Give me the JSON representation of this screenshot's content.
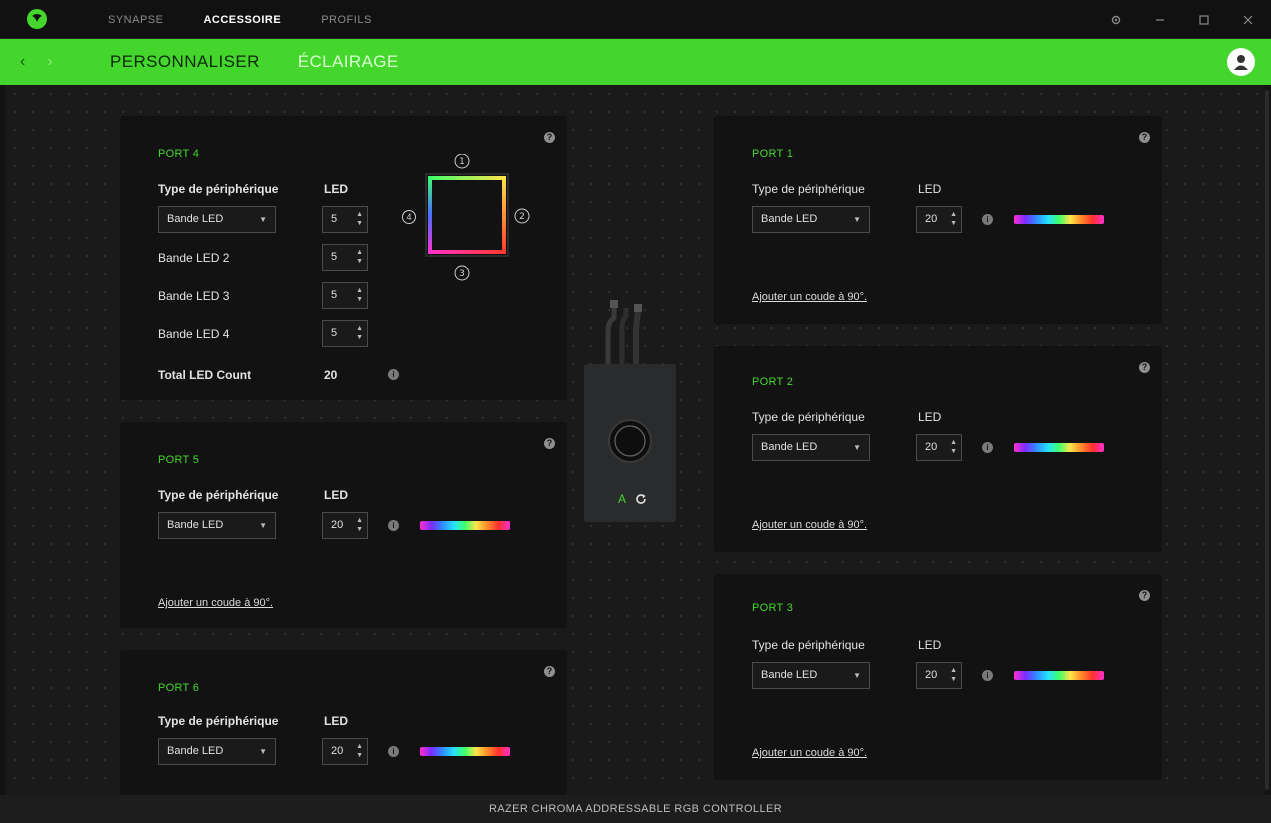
{
  "window": {
    "nav": [
      "SYNAPSE",
      "ACCESSOIRE",
      "PROFILS"
    ],
    "active_nav": 1
  },
  "subnav": {
    "tabs": [
      "PERSONNALISER",
      "ÉCLAIRAGE"
    ],
    "active_tab": 0
  },
  "labels": {
    "device_type": "Type de périphérique",
    "led": "LED",
    "add_bend": "Ajouter un coude à 90°."
  },
  "ports": {
    "port4": {
      "title": "PORT 4",
      "device_type": "Bande LED",
      "led": "5",
      "strips": [
        {
          "label": "Bande LED  2",
          "value": "5"
        },
        {
          "label": "Bande LED  3",
          "value": "5"
        },
        {
          "label": "Bande LED  4",
          "value": "5"
        }
      ],
      "total_label": "Total LED Count",
      "total_value": "20",
      "ring_labels": [
        "1",
        "2",
        "3",
        "4"
      ]
    },
    "port5": {
      "title": "PORT 5",
      "device_type": "Bande LED",
      "led": "20"
    },
    "port6": {
      "title": "PORT 6",
      "device_type": "Bande LED",
      "led": "20"
    },
    "port1": {
      "title": "PORT 1",
      "device_type": "Bande LED",
      "led": "20"
    },
    "port2": {
      "title": "PORT 2",
      "device_type": "Bande LED",
      "led": "20"
    },
    "port3": {
      "title": "PORT 3",
      "device_type": "Bande LED",
      "led": "20"
    }
  },
  "device": {
    "status_letter": "A"
  },
  "footer": {
    "device_name": "RAZER CHROMA ADDRESSABLE RGB CONTROLLER"
  },
  "colors": {
    "accent": "#44d62c",
    "card_bg": "#121212",
    "app_bg": "#1a1a1a"
  },
  "icons": {
    "logo": "razer-snake-icon",
    "help": "help-icon",
    "info": "info-icon",
    "refresh": "refresh-icon"
  }
}
